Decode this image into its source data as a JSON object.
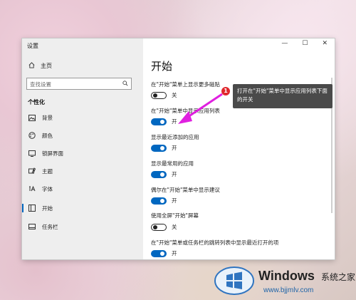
{
  "window": {
    "title": "设置"
  },
  "sidebar": {
    "home_label": "主页",
    "search_placeholder": "查找设置",
    "section_heading": "个性化",
    "items": [
      {
        "icon": "image-icon",
        "label": "背景"
      },
      {
        "icon": "palette-icon",
        "label": "颜色"
      },
      {
        "icon": "lock-screen-icon",
        "label": "锁屏界面"
      },
      {
        "icon": "theme-icon",
        "label": "主题"
      },
      {
        "icon": "font-icon",
        "label": "字体"
      },
      {
        "icon": "start-icon",
        "label": "开始",
        "selected": true
      },
      {
        "icon": "taskbar-icon",
        "label": "任务栏"
      }
    ]
  },
  "titlebar_buttons": [
    "—",
    "☐",
    "✕"
  ],
  "main": {
    "title": "开始",
    "settings": [
      {
        "label": "在\"开始\"菜单上显示更多磁贴",
        "state": "关",
        "on": false
      },
      {
        "label": "在\"开始\"菜单中显示应用列表",
        "state": "开",
        "on": true
      },
      {
        "label": "显示最近添加的应用",
        "state": "开",
        "on": true
      },
      {
        "label": "显示最常用的应用",
        "state": "开",
        "on": true
      },
      {
        "label": "偶尔在\"开始\"菜单中显示建议",
        "state": "开",
        "on": true
      },
      {
        "label": "使用全屏\"开始\"屏幕",
        "state": "关",
        "on": false
      },
      {
        "label": "在\"开始\"菜单或任务栏的跳转列表中显示最近打开的项",
        "state": "开",
        "on": true
      }
    ]
  },
  "annotation": {
    "badge": "1",
    "text": "打开在\"开始\"菜单中显示应用列表下面的开关",
    "color": "#e0282d",
    "arrow_color": "#e020e0"
  },
  "watermark": {
    "brand": "Windows",
    "suffix": "系统之家",
    "url": "www.bjjmlv.com"
  },
  "colors": {
    "accent": "#0067c0"
  }
}
